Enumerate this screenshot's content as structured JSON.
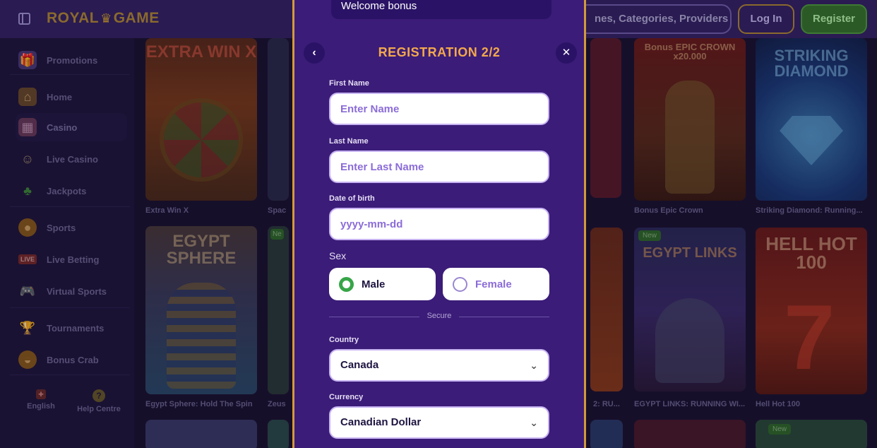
{
  "header": {
    "logo_text": "ROYAL",
    "logo_text2": "GAME",
    "search_placeholder": "nes, Categories, Providers",
    "login_label": "Log In",
    "register_label": "Register"
  },
  "sidebar": {
    "items": [
      {
        "label": "Promotions",
        "icon": "gift-icon"
      },
      {
        "label": "Home",
        "icon": "home-icon"
      },
      {
        "label": "Casino",
        "icon": "slot-machine-icon"
      },
      {
        "label": "Live Casino",
        "icon": "dealer-icon"
      },
      {
        "label": "Jackpots",
        "icon": "clover-icon"
      },
      {
        "label": "Sports",
        "icon": "ball-icon"
      },
      {
        "label": "Live Betting",
        "icon": "live-badge-icon"
      },
      {
        "label": "Virtual Sports",
        "icon": "gamepad-icon"
      },
      {
        "label": "Tournaments",
        "icon": "trophy-icon"
      },
      {
        "label": "Bonus Crab",
        "icon": "crab-icon"
      }
    ],
    "live_badge": "LIVE",
    "footer": {
      "language": "English",
      "help": "Help Centre"
    }
  },
  "games": [
    {
      "caption": "Extra Win X",
      "art": "EXTRA WIN X"
    },
    {
      "caption": "Spac",
      "art": ""
    },
    {
      "caption": "Bonus Epic Crown",
      "art": "Bonus EPIC CROWN x20.000"
    },
    {
      "caption": "Striking Diamond: Running...",
      "art": "STRIKING DIAMOND"
    },
    {
      "caption": "Egypt Sphere: Hold The Spin",
      "art": "EGYPT SPHERE"
    },
    {
      "caption": "Zeus",
      "art": ""
    },
    {
      "caption": "2: RU...",
      "art": ""
    },
    {
      "caption": "EGYPT LINKS: RUNNING WI...",
      "art": "EGYPT LINKS"
    },
    {
      "caption": "Hell Hot 100",
      "art": "HELL HOT 100"
    }
  ],
  "new_badge": "New",
  "new_badge_short": "Ne",
  "modal": {
    "bonus_text": "Welcome bonus",
    "title": "REGISTRATION 2/2",
    "back_icon": "chevron-left-icon",
    "close_icon": "close-icon",
    "first_name": {
      "label": "First Name",
      "placeholder": "Enter Name"
    },
    "last_name": {
      "label": "Last Name",
      "placeholder": "Enter Last Name"
    },
    "dob": {
      "label": "Date of birth",
      "placeholder": "yyyy-mm-dd"
    },
    "sex": {
      "label": "Sex",
      "options": [
        "Male",
        "Female"
      ],
      "selected": "Male"
    },
    "secure_text": "Secure",
    "country": {
      "label": "Country",
      "value": "Canada"
    },
    "currency": {
      "label": "Currency",
      "value": "Canadian Dollar"
    }
  },
  "colors": {
    "modal_bg": "#3b1c78",
    "accent_gold": "#f3a94c",
    "radio_green": "#37a548",
    "input_text": "#8b6cd8"
  }
}
